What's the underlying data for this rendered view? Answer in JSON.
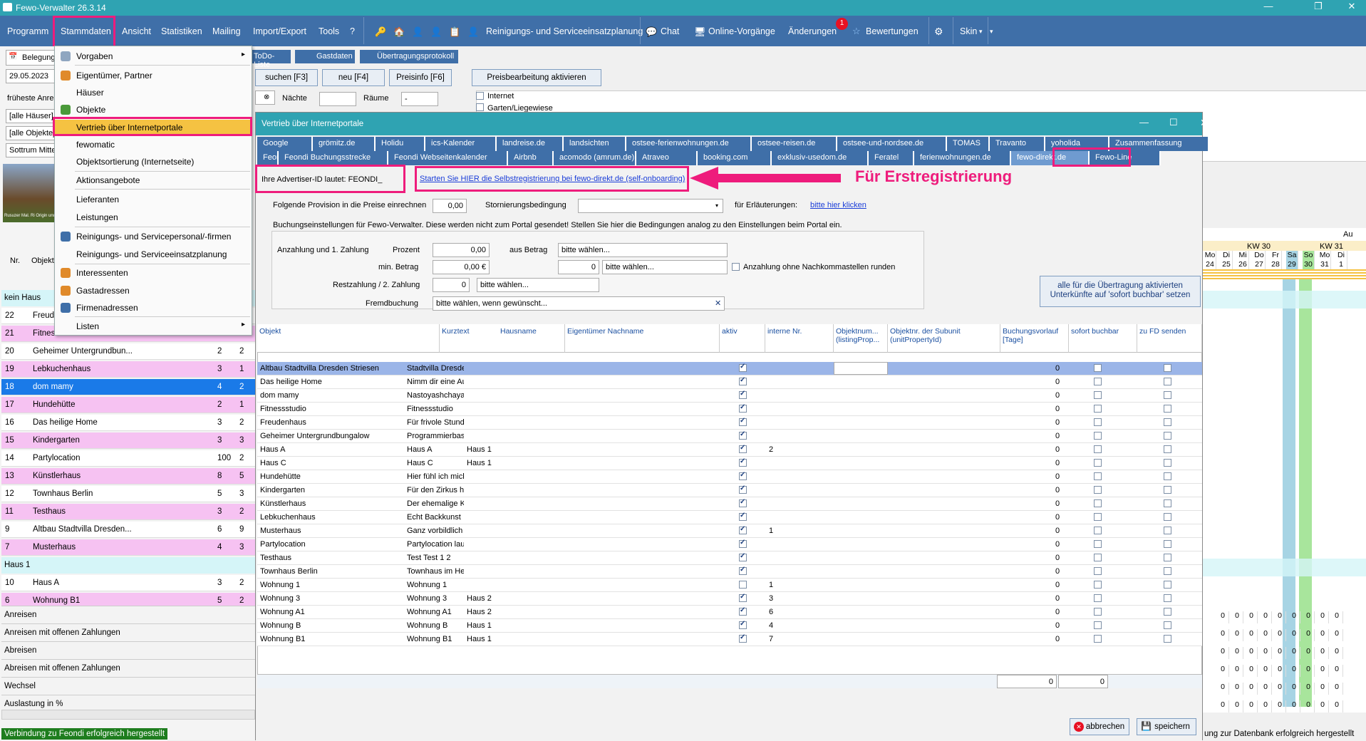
{
  "app": {
    "title": "Fewo-Verwalter 26.3.14"
  },
  "menu": [
    "Programm",
    "Stammdaten",
    "Ansicht",
    "Statistiken",
    "Mailing",
    "Import/Export",
    "Tools",
    "?"
  ],
  "toolbar": {
    "reinigung": "Reinigungs- und Serviceeinsatzplanung",
    "chat": "Chat",
    "online": "Online-Vorgänge",
    "aenderungen": "Änderungen",
    "badge": "1",
    "bewertungen": "Bewertungen",
    "skin": "Skin"
  },
  "dropdown": [
    "Vorgaben",
    "Eigentümer, Partner",
    "Häuser",
    "Objekte",
    "Vertrieb über Internetportale",
    "fewomatic",
    "Objektsortierung (Internetseite)",
    "Aktionsangebote",
    "Lieferanten",
    "Leistungen",
    "Reinigungs- und Servicepersonal/-firmen",
    "Reinigungs- und Serviceeinsatzplanung",
    "Interessenten",
    "Gastadressen",
    "Firmenadressen",
    "Listen"
  ],
  "left": {
    "tab": "Belegung",
    "date": "29.05.2023",
    "label1": "früheste Anrei",
    "sel1": "[alle Häuser]",
    "sel2": "[alle Objekte]",
    "sel3": "Sottrum Mitte",
    "caption": "Rusuzer Mal. Ri Origin und",
    "hdr_nr": "Nr.",
    "hdr_obj": "Objekt",
    "rows": [
      {
        "kind": "cat",
        "text": "kein Haus"
      },
      {
        "kind": "row",
        "nr": "22",
        "name": "Freud",
        "a": "",
        "b": "",
        "style": ""
      },
      {
        "kind": "row",
        "nr": "21",
        "name": "Fitnessstudio",
        "a": "3",
        "b": "3",
        "style": "pink"
      },
      {
        "kind": "row",
        "nr": "20",
        "name": "Geheimer Untergrundbun...",
        "a": "2",
        "b": "2",
        "style": ""
      },
      {
        "kind": "row",
        "nr": "19",
        "name": "Lebkuchenhaus",
        "a": "3",
        "b": "1",
        "style": "pink"
      },
      {
        "kind": "row",
        "nr": "18",
        "name": "dom mamy",
        "a": "4",
        "b": "2",
        "style": "sel"
      },
      {
        "kind": "row",
        "nr": "17",
        "name": "Hundehütte",
        "a": "2",
        "b": "1",
        "style": "pink"
      },
      {
        "kind": "row",
        "nr": "16",
        "name": "Das heilige Home",
        "a": "3",
        "b": "2",
        "style": ""
      },
      {
        "kind": "row",
        "nr": "15",
        "name": "Kindergarten",
        "a": "3",
        "b": "3",
        "style": "pink"
      },
      {
        "kind": "row",
        "nr": "14",
        "name": "Partylocation",
        "a": "100",
        "b": "2",
        "style": ""
      },
      {
        "kind": "row",
        "nr": "13",
        "name": "Künstlerhaus",
        "a": "8",
        "b": "5",
        "style": "pink"
      },
      {
        "kind": "row",
        "nr": "12",
        "name": "Townhaus Berlin",
        "a": "5",
        "b": "3",
        "style": ""
      },
      {
        "kind": "row",
        "nr": "11",
        "name": "Testhaus",
        "a": "3",
        "b": "2",
        "style": "pink"
      },
      {
        "kind": "row",
        "nr": "9",
        "name": "Altbau Stadtvilla Dresden...",
        "a": "6",
        "b": "9",
        "style": ""
      },
      {
        "kind": "row",
        "nr": "7",
        "name": "Musterhaus",
        "a": "4",
        "b": "3",
        "style": "pink"
      },
      {
        "kind": "cat",
        "text": "Haus 1"
      },
      {
        "kind": "row",
        "nr": "10",
        "name": "Haus A",
        "a": "3",
        "b": "2",
        "style": ""
      },
      {
        "kind": "row",
        "nr": "6",
        "name": "Wohnung B1",
        "a": "5",
        "b": "2",
        "style": "pink"
      }
    ],
    "bottom": [
      "Anreisen",
      "Anreisen mit offenen Zahlungen",
      "Abreisen",
      "Abreisen mit offenen Zahlungen",
      "Wechsel",
      "Auslastung in %"
    ],
    "status": "Verbindung zu Feondi erfolgreich hergestellt"
  },
  "toptabs": [
    "ToDo-Liste",
    "Gastdaten",
    "Übertragungsprotokoll"
  ],
  "topbtns": {
    "suchen": "suchen [F3]",
    "neu": "neu [F4]",
    "preisinfo": "Preisinfo [F6]",
    "preis": "Preisbearbeitung aktivieren",
    "naechte": "Nächte",
    "raeume": "Räume",
    "raeume_val": "-",
    "internet": "Internet",
    "garten": "Garten/Liegewiese"
  },
  "calendar": {
    "au": "Au",
    "kw30": "KW 30",
    "kw31": "KW 31",
    "days": [
      "Mo",
      "Di",
      "Mi",
      "Do",
      "Fr",
      "Sa",
      "So",
      "Mo",
      "Di"
    ],
    "dates": [
      "24",
      "25",
      "26",
      "27",
      "28",
      "29",
      "30",
      "31",
      "1"
    ],
    "zero": "0",
    "status": "ung zur Datenbank erfolgreich hergestellt"
  },
  "dialog": {
    "title": "Vertrieb über Internetportale",
    "tabs1": [
      "Google",
      "grömitz.de",
      "Holidu",
      "ics-Kalender",
      "landreise.de",
      "landsichten",
      "ostsee-ferienwohnungen.de",
      "ostsee-reisen.de",
      "ostsee-und-nordsee.de",
      "TOMAS",
      "Travanto",
      "yoholida",
      "Zusammenfassung"
    ],
    "tabs2": [
      "Feondi",
      "Feondi Buchungsstrecke",
      "Feondi Webseitenkalender",
      "Airbnb",
      "acomodo (amrum.de)",
      "Atraveo",
      "booking.com",
      "exklusiv-usedom.de",
      "Feratel",
      "ferienwohnungen.de",
      "fewo-direkt.de",
      "Fewo-Line"
    ],
    "advertiser": "Ihre Advertiser-ID lautet: FEONDI_",
    "link": "Starten Sie HIER die Selbstregistrierung bei fewo-direkt.de (self-onboarding)",
    "annotation": "Für Erstregistrierung",
    "provision_lbl": "Folgende Provision in die Preise einrechnen",
    "provision_val": "0,00",
    "storno_lbl": "Stornierungsbedingung",
    "erl_lbl": "für Erläuterungen:",
    "erl_link": "bitte hier klicken",
    "booking_note": "Buchungseinstellungen für Fewo-Verwalter. Diese werden nicht zum Portal gesendet! Stellen Sie hier die Bedingungen analog zu den Einstellungen beim Portal ein.",
    "anz_lbl": "Anzahlung und 1. Zahlung",
    "prozent_lbl": "Prozent",
    "prozent_val": "0,00",
    "ausbetrag_lbl": "aus Betrag",
    "ausbetrag_val": "bitte wählen...",
    "min_lbl": "min. Betrag",
    "min_val": "0,00 €",
    "min_num": "0",
    "min_sel": "bitte wählen...",
    "round_lbl": "Anzahlung ohne Nachkommastellen runden",
    "rest_lbl": "Restzahlung / 2. Zahlung",
    "rest_num": "0",
    "rest_sel": "bitte wählen...",
    "fremd_lbl": "Fremdbuchung",
    "fremd_val": "bitte wählen, wenn gewünscht...",
    "activate_btn": "alle für die Übertragung aktivierten Unterkünfte auf 'sofort buchbar' setzen",
    "cols": [
      "Objekt",
      "Kurztext",
      "Hausname",
      "Eigentümer Nachname",
      "aktiv",
      "interne Nr.",
      "Objektnum... (listingProp...",
      "Objektnr. der Subunit (unitPropertyId)",
      "Buchungsvorlauf [Tage]",
      "sofort buchbar",
      "zu FD senden"
    ],
    "rows": [
      {
        "o": "Altbau Stadtvilla Dresden Striesen",
        "k": "Stadtvilla Dresde...",
        "h": "",
        "a": true,
        "n": "",
        "v": "0"
      },
      {
        "o": "Das heilige Home",
        "k": "Nimm dir eine Aus...",
        "h": "",
        "a": true,
        "n": "",
        "v": "0"
      },
      {
        "o": "dom mamy",
        "k": "Nastoyashchaya...",
        "h": "",
        "a": true,
        "n": "",
        "v": "0"
      },
      {
        "o": "Fitnessstudio",
        "k": "Fitnessstudio",
        "h": "",
        "a": true,
        "n": "",
        "v": "0"
      },
      {
        "o": "Freudenhaus",
        "k": "Für frivole Stunden",
        "h": "",
        "a": true,
        "n": "",
        "v": "0"
      },
      {
        "o": "Geheimer Untergrundbungalow",
        "k": "Programmierbasis...",
        "h": "",
        "a": true,
        "n": "",
        "v": "0"
      },
      {
        "o": "Haus A",
        "k": "Haus A",
        "h": "Haus 1",
        "a": true,
        "n": "2",
        "v": "0"
      },
      {
        "o": "Haus C",
        "k": "Haus C",
        "h": "Haus 1",
        "a": true,
        "n": "",
        "v": "0"
      },
      {
        "o": "Hundehütte",
        "k": "Hier fühl ich mich...",
        "h": "",
        "a": true,
        "n": "",
        "v": "0"
      },
      {
        "o": "Kindergarten",
        "k": "Für den Zirkus hier",
        "h": "",
        "a": true,
        "n": "",
        "v": "0"
      },
      {
        "o": "Künstlerhaus",
        "k": "Der ehemalige Ko...",
        "h": "",
        "a": true,
        "n": "",
        "v": "0"
      },
      {
        "o": "Lebkuchenhaus",
        "k": "Echt Backkunst",
        "h": "",
        "a": true,
        "n": "",
        "v": "0"
      },
      {
        "o": "Musterhaus",
        "k": "Ganz vorbildlich",
        "h": "",
        "a": true,
        "n": "1",
        "v": "0"
      },
      {
        "o": "Partylocation",
        "k": "Partylocation laut...",
        "h": "",
        "a": true,
        "n": "",
        "v": "0"
      },
      {
        "o": "Testhaus",
        "k": "Test Test 1 2",
        "h": "",
        "a": true,
        "n": "",
        "v": "0"
      },
      {
        "o": "Townhaus Berlin",
        "k": "Townhaus im Her...",
        "h": "",
        "a": true,
        "n": "",
        "v": "0"
      },
      {
        "o": "Wohnung 1",
        "k": "Wohnung 1",
        "h": "",
        "a": false,
        "n": "1",
        "v": "0"
      },
      {
        "o": "Wohnung 3",
        "k": "Wohnung 3",
        "h": "Haus 2",
        "a": true,
        "n": "3",
        "v": "0"
      },
      {
        "o": "Wohnung A1",
        "k": "Wohnung A1",
        "h": "Haus 2",
        "a": true,
        "n": "6",
        "v": "0"
      },
      {
        "o": "Wohnung B",
        "k": "Wohnung B",
        "h": "Haus 1",
        "a": true,
        "n": "4",
        "v": "0"
      },
      {
        "o": "Wohnung B1",
        "k": "Wohnung B1",
        "h": "Haus 1",
        "a": true,
        "n": "7",
        "v": "0"
      }
    ],
    "sum1": "0",
    "sum2": "0",
    "cancel": "abbrechen",
    "save": "speichern"
  },
  "colors": {
    "accent": "#3f6fa8",
    "title": "#2fa3b2",
    "highlight": "#ee1c7c",
    "pink": "#f6c2f2",
    "select": "#1a7ae8"
  }
}
